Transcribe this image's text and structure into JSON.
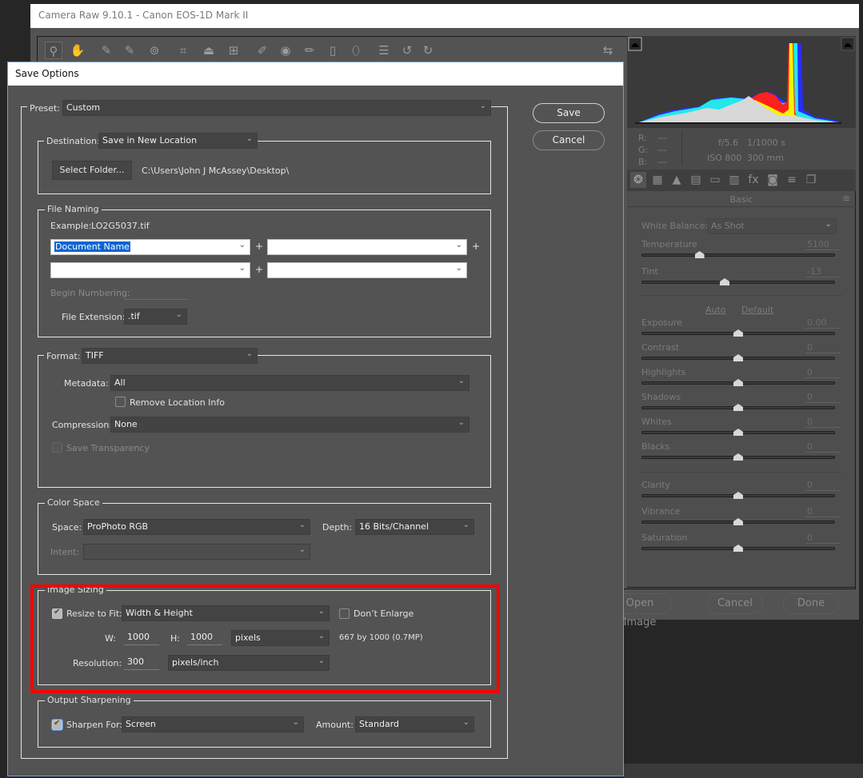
{
  "camera_raw": {
    "window_title": "Camera Raw 9.10.1  -  Canon EOS-1D Mark II",
    "toolbar": [
      {
        "name": "zoom-tool",
        "glyph": "⚲",
        "active": true
      },
      {
        "name": "hand-tool",
        "glyph": "✋"
      },
      {
        "name": "white-balance-tool",
        "glyph": "✎"
      },
      {
        "name": "color-sampler-tool",
        "glyph": "✎"
      },
      {
        "name": "targeted-adjustment-tool",
        "glyph": "⊚"
      },
      {
        "name": "crop-tool",
        "glyph": "⌗"
      },
      {
        "name": "straighten-tool",
        "glyph": "⏏"
      },
      {
        "name": "transform-tool",
        "glyph": "⊞"
      },
      {
        "name": "spot-removal-tool",
        "glyph": "✐"
      },
      {
        "name": "red-eye-tool",
        "glyph": "◉"
      },
      {
        "name": "adjustment-brush-tool",
        "glyph": "✏"
      },
      {
        "name": "graduated-filter-tool",
        "glyph": "▯"
      },
      {
        "name": "radial-filter-tool",
        "glyph": "⬯"
      },
      {
        "name": "preferences-tool",
        "glyph": "☰"
      },
      {
        "name": "rotate-left-tool",
        "glyph": "↺"
      },
      {
        "name": "rotate-right-tool",
        "glyph": "↻"
      }
    ],
    "fullscreen_glyph": "⇆",
    "info": {
      "r_label": "R:",
      "g_label": "G:",
      "b_label": "B:",
      "r_value": "---",
      "g_value": "---",
      "b_value": "---",
      "aperture": "f/5.6",
      "shutter": "1/1000 s",
      "iso": "ISO 800",
      "focal_length": "300 mm"
    },
    "panel_tabs": [
      {
        "name": "basic",
        "glyph": "❂"
      },
      {
        "name": "tone-curve",
        "glyph": "▦"
      },
      {
        "name": "detail",
        "glyph": "▲"
      },
      {
        "name": "hsl",
        "glyph": "▤"
      },
      {
        "name": "split-toning",
        "glyph": "▭"
      },
      {
        "name": "lens-corrections",
        "glyph": "▥"
      },
      {
        "name": "effects",
        "glyph": "fx"
      },
      {
        "name": "camera-calibration",
        "glyph": "◙"
      },
      {
        "name": "presets",
        "glyph": "≡"
      },
      {
        "name": "snapshots",
        "glyph": "❐"
      }
    ],
    "panel_title": "Basic",
    "white_balance_label": "White Balance:",
    "white_balance_value": "As Shot",
    "auto_link": "Auto",
    "default_link": "Default",
    "sliders": [
      {
        "label": "Temperature",
        "value": "5100",
        "position": 0.3
      },
      {
        "label": "Tint",
        "value": "-13",
        "position": 0.43
      },
      {
        "label": "Exposure",
        "value": "0.00",
        "position": 0.5
      },
      {
        "label": "Contrast",
        "value": "0",
        "position": 0.5
      },
      {
        "label": "Highlights",
        "value": "0",
        "position": 0.5
      },
      {
        "label": "Shadows",
        "value": "0",
        "position": 0.5
      },
      {
        "label": "Whites",
        "value": "0",
        "position": 0.5
      },
      {
        "label": "Blacks",
        "value": "0",
        "position": 0.5
      },
      {
        "label": "Clarity",
        "value": "0",
        "position": 0.5
      },
      {
        "label": "Vibrance",
        "value": "0",
        "position": 0.5
      },
      {
        "label": "Saturation",
        "value": "0",
        "position": 0.5
      }
    ],
    "footer": {
      "open_image": "Open Image",
      "cancel": "Cancel",
      "done": "Done"
    }
  },
  "dialog": {
    "title": "Save Options",
    "save_button": "Save",
    "cancel_button": "Cancel",
    "preset_label": "Preset:",
    "preset_value": "Custom",
    "destination": {
      "label": "Destination:",
      "value": "Save in New Location",
      "select_folder_button": "Select Folder...",
      "path": "C:\\Users\\John J McAssey\\Desktop\\"
    },
    "file_naming": {
      "legend": "File Naming",
      "example_label": "Example:",
      "example_value": "LO2G5037.tif",
      "fields": [
        "Document Name",
        "",
        "",
        ""
      ],
      "plus": "+",
      "begin_numbering_label": "Begin Numbering:",
      "begin_numbering_value": "",
      "file_extension_label": "File Extension:",
      "file_extension_value": ".tif"
    },
    "format": {
      "label": "Format:",
      "value": "TIFF",
      "metadata_label": "Metadata:",
      "metadata_value": "All",
      "remove_location_label": "Remove Location Info",
      "remove_location_checked": false,
      "compression_label": "Compression:",
      "compression_value": "None",
      "save_transparency_label": "Save Transparency",
      "save_transparency_checked": false
    },
    "color_space": {
      "legend": "Color Space",
      "space_label": "Space:",
      "space_value": "ProPhoto RGB",
      "depth_label": "Depth:",
      "depth_value": "16 Bits/Channel",
      "intent_label": "Intent:",
      "intent_value": ""
    },
    "image_sizing": {
      "legend": "Image Sizing",
      "resize_label": "Resize to Fit:",
      "resize_checked": true,
      "resize_value": "Width & Height",
      "dont_enlarge_label": "Don’t Enlarge",
      "dont_enlarge_checked": false,
      "w_label": "W:",
      "w_value": "1000",
      "h_label": "H:",
      "h_value": "1000",
      "unit_value": "pixels",
      "result_text": "667 by 1000 (0.7MP)",
      "resolution_label": "Resolution:",
      "resolution_value": "300",
      "resolution_unit": "pixels/inch"
    },
    "output_sharpening": {
      "legend": "Output Sharpening",
      "sharpen_label": "Sharpen For:",
      "sharpen_checked": true,
      "sharpen_value": "Screen",
      "amount_label": "Amount:",
      "amount_value": "Standard"
    }
  },
  "colors": {
    "highlight_box": "#ff0000",
    "dialog_accent": "#6e9fd8",
    "selection": "#0a64d2"
  }
}
